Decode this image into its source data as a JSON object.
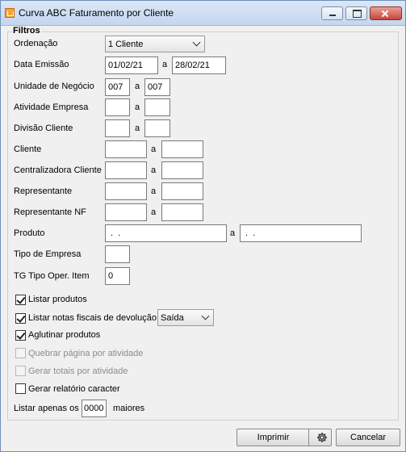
{
  "window": {
    "title": "Curva ABC Faturamento por Cliente"
  },
  "filters": {
    "title": "Filtros",
    "ordenacao": {
      "label": "Ordenação",
      "value": "1 Cliente"
    },
    "data_emissao": {
      "label": "Data Emissão",
      "from": "01/02/21",
      "sep": "a",
      "to": "28/02/21"
    },
    "unidade_negocio": {
      "label": "Unidade de Negócio",
      "from": "007",
      "sep": "a",
      "to": "007"
    },
    "atividade_empresa": {
      "label": "Atividade Empresa",
      "from": "",
      "sep": "a",
      "to": ""
    },
    "divisao_cliente": {
      "label": "Divisão Cliente",
      "from": "",
      "sep": "a",
      "to": ""
    },
    "cliente": {
      "label": "Cliente",
      "from": "",
      "sep": "a",
      "to": ""
    },
    "centralizadora": {
      "label": "Centralizadora Cliente",
      "from": "",
      "sep": "a",
      "to": ""
    },
    "representante": {
      "label": "Representante",
      "from": "",
      "sep": "a",
      "to": ""
    },
    "representante_nf": {
      "label": "Representante NF",
      "from": "",
      "sep": "a",
      "to": ""
    },
    "produto": {
      "label": "Produto",
      "from": " .  .",
      "sep": "a",
      "to": " .  ."
    },
    "tipo_empresa": {
      "label": "Tipo de Empresa",
      "value": ""
    },
    "tg_tipo_oper": {
      "label": "TG Tipo Oper. Item",
      "value": "0"
    }
  },
  "options": {
    "listar_produtos": {
      "label": "Listar produtos",
      "checked": true
    },
    "listar_notas": {
      "label": "Listar notas fiscais de devolução",
      "checked": true,
      "select_value": "Saída"
    },
    "aglutinar": {
      "label": "Aglutinar produtos",
      "checked": true
    },
    "quebrar_pagina": {
      "label": "Quebrar página por atividade",
      "checked": false,
      "disabled": true
    },
    "gerar_totais": {
      "label": "Gerar totais por atividade",
      "checked": false,
      "disabled": true
    },
    "gerar_relatorio": {
      "label": "Gerar relatório caracter",
      "checked": false
    }
  },
  "listar_apenas": {
    "prefix": "Listar apenas os",
    "value": "0000",
    "suffix": "maiores"
  },
  "buttons": {
    "print": "Imprimir",
    "settings_icon": "gear-icon",
    "cancel": "Cancelar"
  }
}
